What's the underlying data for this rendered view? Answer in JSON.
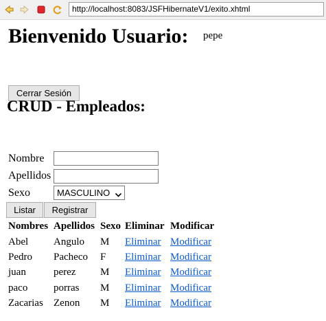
{
  "browser": {
    "url": "http://localhost:8083/JSFHibernateV1/exito.xhtml",
    "icons": [
      "back-icon",
      "forward-icon",
      "stop-icon",
      "refresh-icon"
    ]
  },
  "header": {
    "welcome": "Bienvenido Usuario:",
    "username": "pepe",
    "logout_label": "Cerrar Sesión"
  },
  "crud": {
    "title": "CRUD - Empleados:",
    "form": {
      "nombre_label": "Nombre",
      "apellidos_label": "Apellidos",
      "sexo_label": "Sexo",
      "nombre_value": "",
      "apellidos_value": "",
      "sexo_selected": "MASCULINO"
    },
    "buttons": {
      "listar": "Listar",
      "registrar": "Registrar"
    },
    "table": {
      "headers": [
        "Nombres",
        "Apellidos",
        "Sexo",
        "Eliminar",
        "Modificar"
      ],
      "rows": [
        [
          "Abel",
          "Angulo",
          "M",
          "Eliminar",
          "Modificar"
        ],
        [
          "Pedro",
          "Pacheco",
          "F",
          "Eliminar",
          "Modificar"
        ],
        [
          "juan",
          "perez",
          "M",
          "Eliminar",
          "Modificar"
        ],
        [
          "paco",
          "porras",
          "M",
          "Eliminar",
          "Modificar"
        ],
        [
          "Zacarias",
          "Zenon",
          "M",
          "Eliminar",
          "Modificar"
        ]
      ]
    }
  },
  "colors": {
    "link": "#0b5ac9",
    "button_bg": "#e6e6e6",
    "toolbar_bg": "#f0f0f0"
  }
}
